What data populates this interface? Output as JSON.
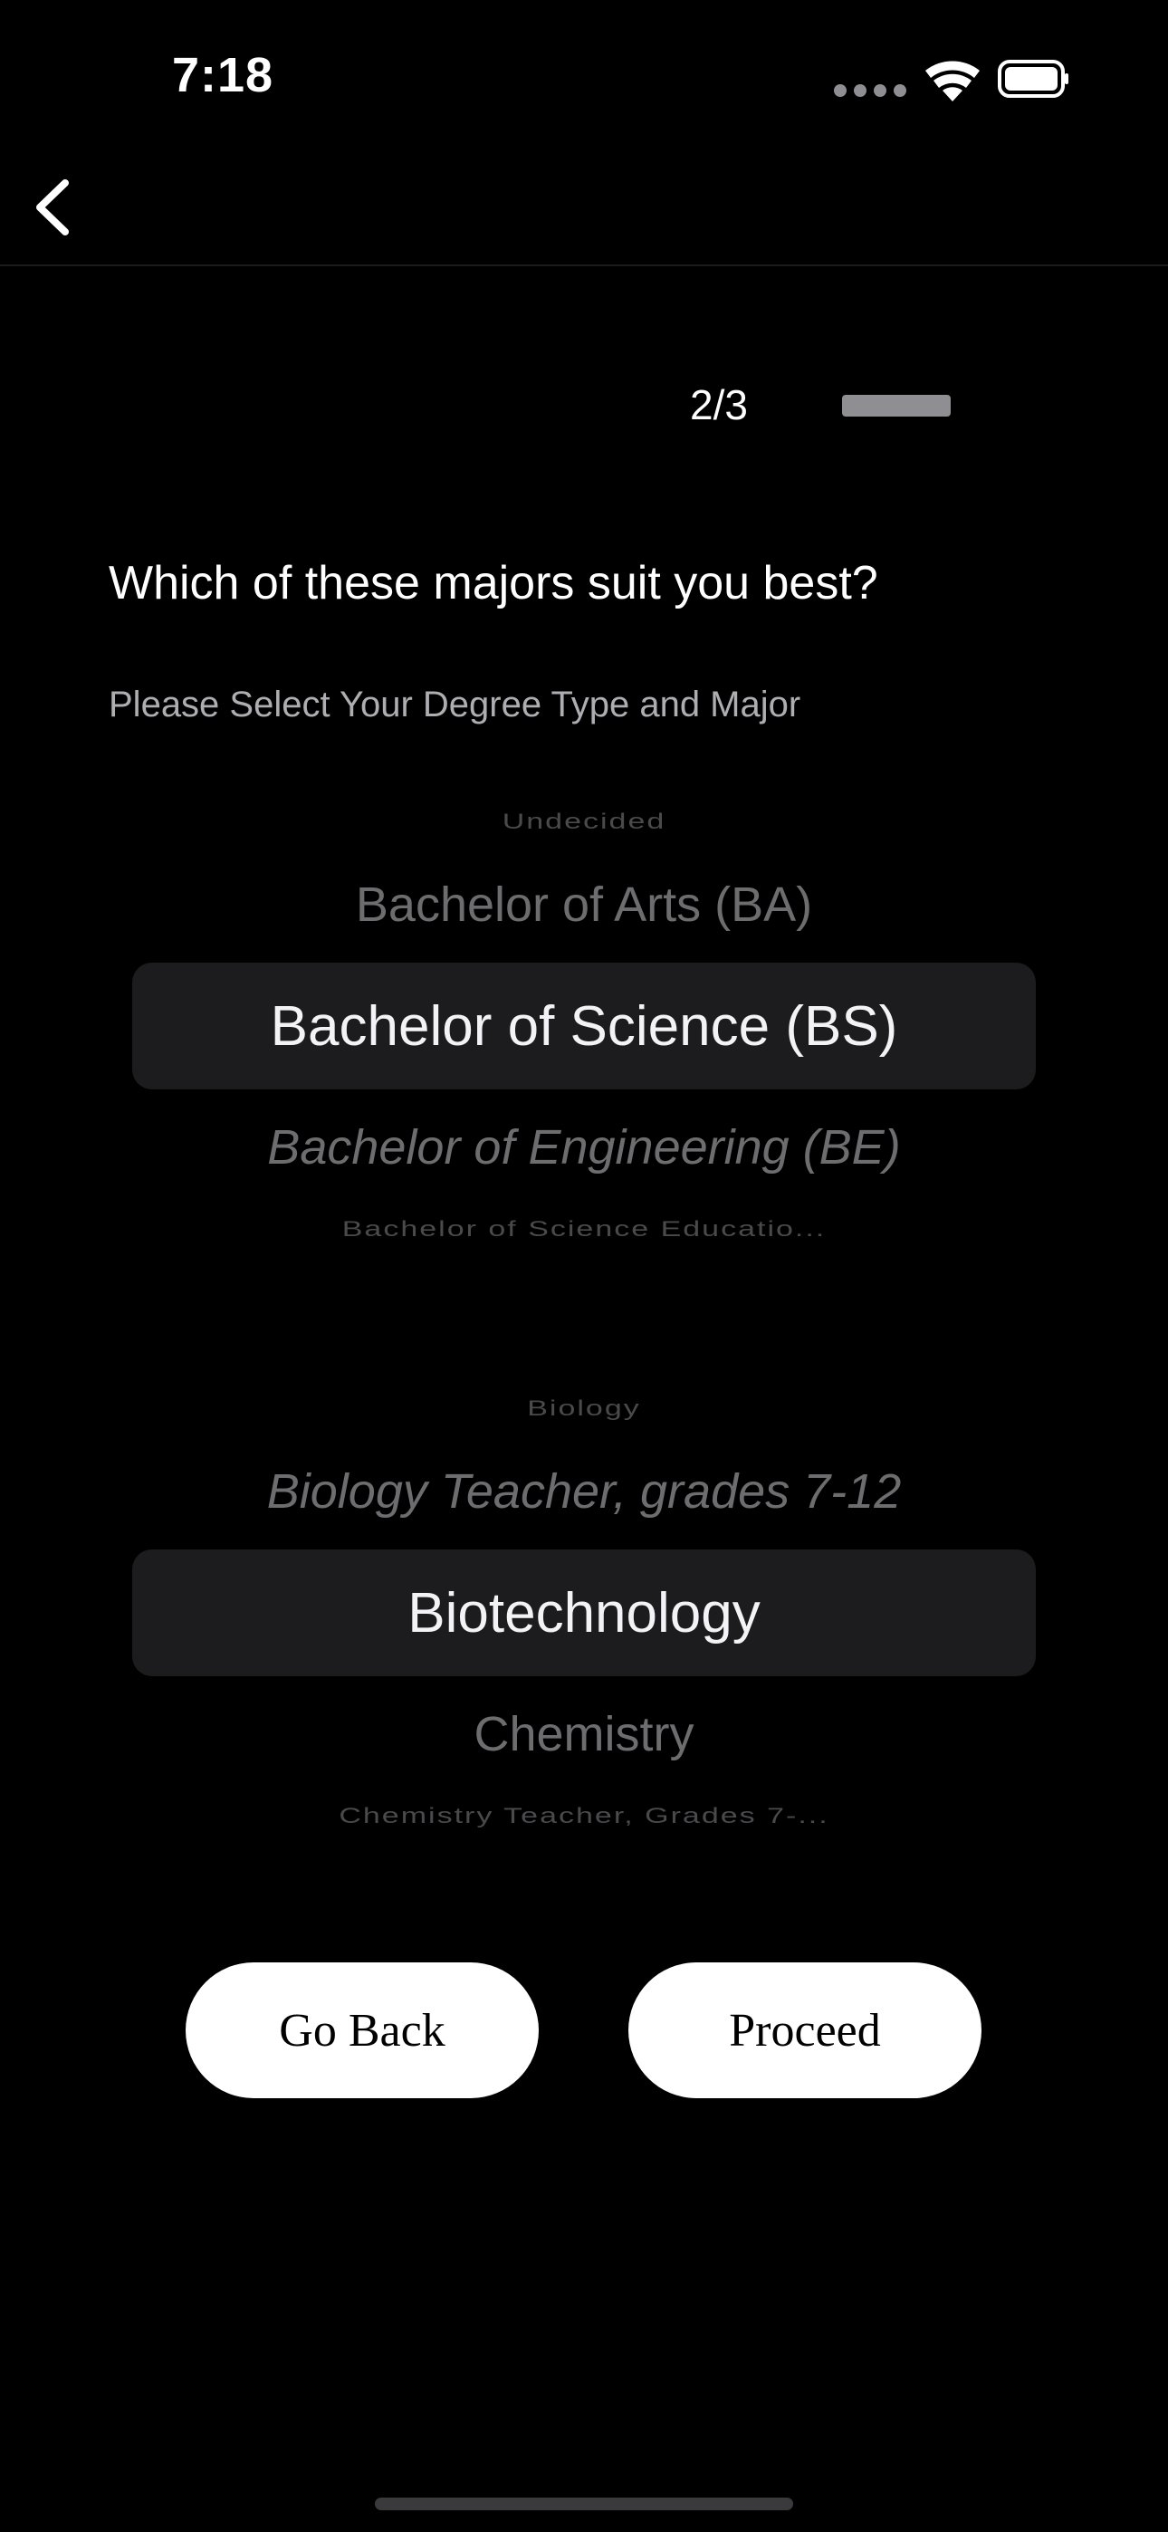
{
  "status_bar": {
    "time": "7:18",
    "icons": [
      "signal-dots-icon",
      "wifi-icon",
      "battery-icon"
    ]
  },
  "nav": {
    "back_icon": "chevron-left-icon"
  },
  "progress": {
    "label": "2/3",
    "fraction": 1.0
  },
  "question": "Which of these majors suit you best?",
  "subtitle": "Please Select Your Degree Type and Major",
  "degree_picker": {
    "options": [
      "Undecided",
      "Bachelor of Arts (BA)",
      "Bachelor of Science (BS)",
      "Bachelor of Engineering (BE)",
      "Bachelor of Science Educatio..."
    ],
    "selected": "Bachelor of Science (BS)"
  },
  "major_picker": {
    "options": [
      "Biology",
      "Biology Teacher, grades 7-12",
      "Biotechnology",
      "Chemistry",
      "Chemistry Teacher, Grades 7-..."
    ],
    "selected": "Biotechnology"
  },
  "buttons": {
    "go_back": "Go Back",
    "proceed": "Proceed"
  },
  "colors": {
    "background": "#000000",
    "picker_highlight": "#1c1c1e",
    "button_background": "#ffffff"
  }
}
